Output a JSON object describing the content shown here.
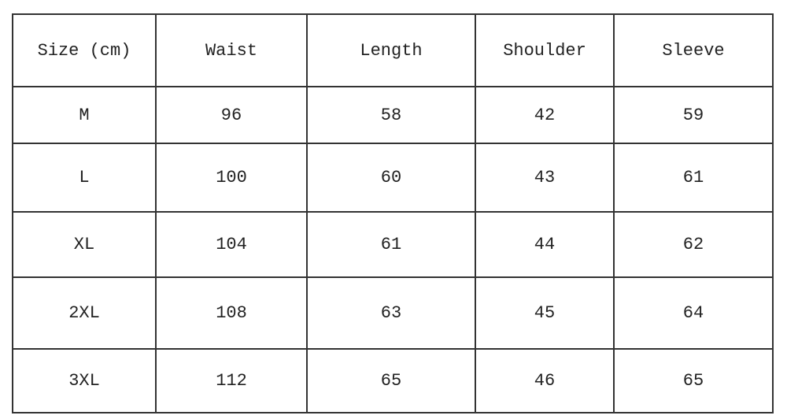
{
  "table": {
    "headers": [
      "Size (cm)",
      "Waist",
      "Length",
      "Shoulder",
      "Sleeve"
    ],
    "rows": [
      [
        "M",
        "96",
        "58",
        "42",
        "59"
      ],
      [
        "L",
        "100",
        "60",
        "43",
        "61"
      ],
      [
        "XL",
        "104",
        "61",
        "44",
        "62"
      ],
      [
        "2XL",
        "108",
        "63",
        "45",
        "64"
      ],
      [
        "3XL",
        "112",
        "65",
        "46",
        "65"
      ]
    ]
  }
}
